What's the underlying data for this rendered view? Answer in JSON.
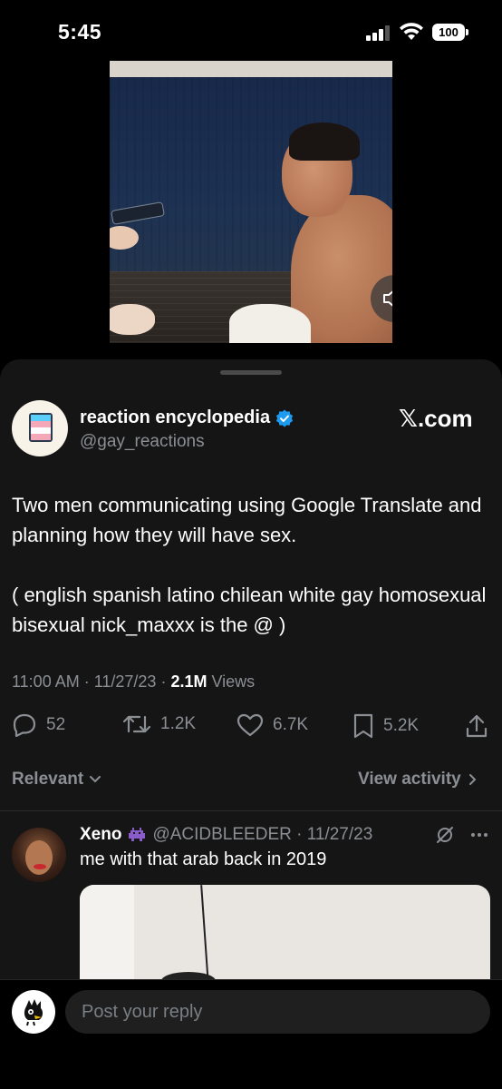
{
  "status_bar": {
    "time": "5:45",
    "battery": "100",
    "icons": [
      "signal-icon",
      "wifi-icon",
      "battery-icon"
    ]
  },
  "video": {
    "controls": [
      "volume-icon",
      "pause-icon"
    ]
  },
  "tweet": {
    "author_name": "reaction encyclopedia",
    "author_handle": "@gay_reactions",
    "verified": true,
    "source_label": "𝕏.com",
    "text": "Two men communicating using Google Translate and planning how they will have sex.\n\n( english spanish latino chilean white gay homosexual bisexual nick_maxxx is the @ )",
    "time_date": "11:00 AM · 11/27/23 · ",
    "views_count": "2.1M",
    "views_label": " Views",
    "actions": {
      "replies": "52",
      "reposts": "1.2K",
      "likes": "6.7K",
      "bookmarks": "5.2K"
    }
  },
  "sort": {
    "relevant": "Relevant",
    "view_activity": "View activity"
  },
  "reply": {
    "name": "Xeno",
    "handle_date": "@ACIDBLEEDER · 11/27/23",
    "text": "me with that arab back in 2019"
  },
  "composer": {
    "placeholder": "Post your reply"
  },
  "colors": {
    "background": "#000000",
    "sheet": "#151515",
    "verified_blue": "#1d9bf0",
    "muted_text": "#8b8f94"
  }
}
